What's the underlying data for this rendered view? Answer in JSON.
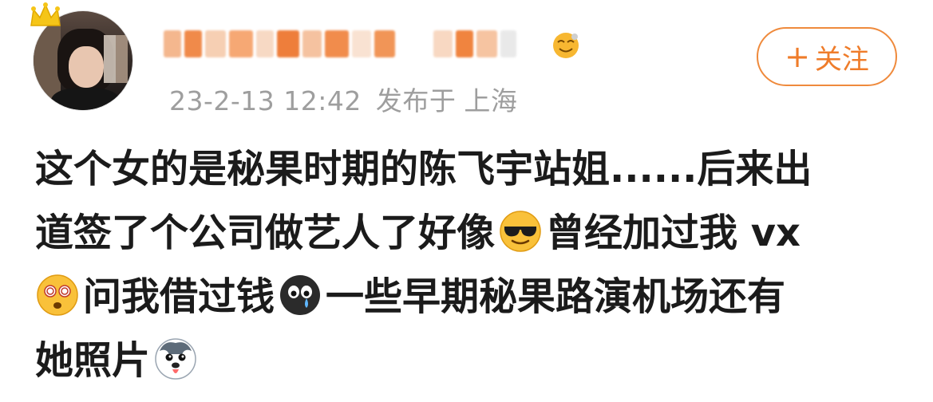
{
  "user": {
    "name_hidden": "",
    "avatar_desc": "avatar",
    "badge_icon": "crown-icon",
    "vip_icon": "vip-emoji-icon"
  },
  "post": {
    "date": "23-2-13 12:42",
    "location_prefix": "发布于",
    "location": "上海",
    "lines": [
      "这个女的是秘果时期的陈飞宇站姐......后来出",
      "道签了个公司做艺人了好像",
      "曾经加过我 vx",
      "问我借过钱",
      "一些早期秘果路演机场还有",
      "她照片"
    ]
  },
  "follow": {
    "plus": "+",
    "label": "关注"
  },
  "colors": {
    "accent": "#ef7c2a",
    "meta": "#9e9e9e",
    "text": "#1b1b1b"
  },
  "icons": {
    "emoji1": "cool-sunglasses-emoji-icon",
    "emoji2": "dizzy-eyes-emoji-icon",
    "emoji3": "crying-black-face-emoji-icon",
    "emoji4": "husky-dog-emoji-icon"
  }
}
